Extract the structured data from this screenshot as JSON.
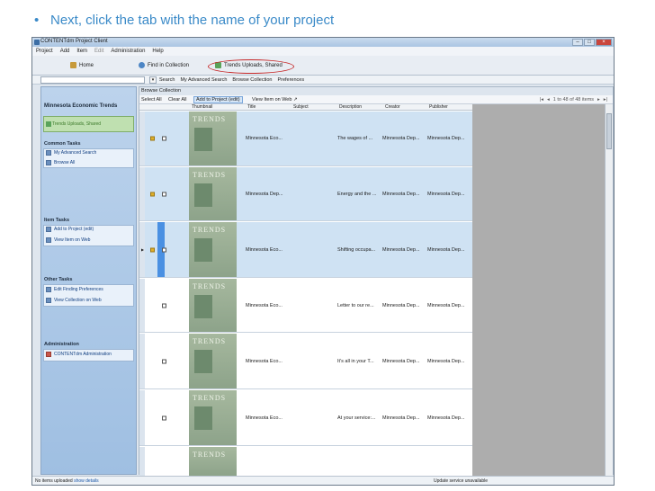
{
  "caption": {
    "bullet": "•",
    "text": "Next, click the tab with the name of your project"
  },
  "window": {
    "title": "CONTENTdm Project Client",
    "menu": [
      "Project",
      "Add",
      "Item",
      "Edit",
      "Administration",
      "Help"
    ],
    "tabs": [
      {
        "label": "Home",
        "icon": "home-icon"
      },
      {
        "label": "Find in Collection",
        "icon": "find-icon"
      },
      {
        "label": "Trends Uploads, Shared",
        "icon": "project-icon"
      }
    ],
    "toolbar2": {
      "search_label": "Search",
      "items": [
        "My Advanced Search",
        "Browse Collection",
        "Preferences"
      ]
    },
    "sidebar": {
      "project_title": "Minnesota Economic Trends",
      "project_item": "Trends Uploads, Shared",
      "common_tasks_title": "Common Tasks",
      "common_tasks": [
        "My Advanced Search",
        "Browse All"
      ],
      "item_tasks_title": "Item Tasks",
      "item_tasks": [
        "Add to Project (edit)",
        "View Item on Web"
      ],
      "other_tasks_title": "Other Tasks",
      "other_tasks": [
        "Edit Finding Preferences",
        "View Collection on Web"
      ],
      "admin_title": "Administration",
      "admin_tasks": [
        "CONTENTdm Administration"
      ]
    },
    "main": {
      "browse_title": "Browse Collection",
      "tools": {
        "select_all": "Select All",
        "clear_all": "Clear All",
        "add_to_project": "Add to Project (edit)",
        "view_item": "View Item on Web"
      },
      "pager_text": "1 to 48 of 48 items",
      "columns": [
        "Thumbnail",
        "Title",
        "Subject",
        "Description",
        "Creator",
        "Publisher"
      ],
      "rows": [
        {
          "title": "Minnesota Eco...",
          "subject": "",
          "description": "The wages of ...",
          "creator": "Minnesota Dep...",
          "publisher": "Minnesota Dep...",
          "thumb": "TRENDS"
        },
        {
          "title": "Minnesota Dep...",
          "subject": "",
          "description": "Energy and the ...",
          "creator": "Minnesota Dep...",
          "publisher": "Minnesota Dep...",
          "thumb": "TRENDS"
        },
        {
          "title": "Minnesota Eco...",
          "subject": "",
          "description": "Shifting occupa...",
          "creator": "Minnesota Dep...",
          "publisher": "Minnesota Dep...",
          "thumb": "TRENDS"
        },
        {
          "title": "Minnesota Eco...",
          "subject": "",
          "description": "Letter to our re...",
          "creator": "Minnesota Dep...",
          "publisher": "Minnesota Dep...",
          "thumb": "TRENDS"
        },
        {
          "title": "Minnesota Eco...",
          "subject": "",
          "description": "It's all in your T...",
          "creator": "Minnesota Dep...",
          "publisher": "Minnesota Dep...",
          "thumb": "TRENDS"
        },
        {
          "title": "Minnesota Eco...",
          "subject": "",
          "description": "At your service:...",
          "creator": "Minnesota Dep...",
          "publisher": "Minnesota Dep...",
          "thumb": "TRENDS"
        },
        {
          "title": "",
          "subject": "",
          "description": "",
          "creator": "",
          "publisher": "",
          "thumb": "TRENDS"
        }
      ]
    },
    "status": {
      "left": "No items uploaded",
      "link": "show details",
      "right": "Update service unavailable"
    }
  }
}
